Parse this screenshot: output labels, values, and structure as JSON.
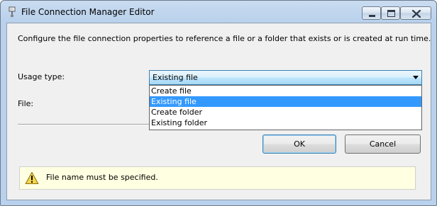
{
  "window": {
    "title": "File Connection Manager Editor",
    "controls": [
      "minimize",
      "maximize",
      "close"
    ]
  },
  "dialog": {
    "description": "Configure the file connection properties to reference a file or a folder that exists or is created at run time.",
    "usage_type_label": "Usage type:",
    "file_label": "File:",
    "usage_type_value": "Existing file",
    "usage_options": [
      "Create file",
      "Existing file",
      "Create folder",
      "Existing folder"
    ],
    "selected_option": "Existing file",
    "ok_label": "OK",
    "cancel_label": "Cancel",
    "message": "File name must be specified."
  },
  "icons": {
    "title": "file-connection-icon",
    "message": "warning-icon"
  },
  "colors": {
    "selection": "#3399ff",
    "message_bg": "#ffffe1"
  }
}
